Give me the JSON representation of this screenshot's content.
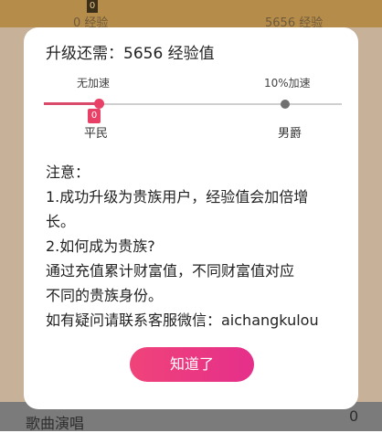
{
  "background": {
    "left_label": "0 经验",
    "right_label": "5656 经验",
    "badge": "0",
    "song_label": "歌曲演唱",
    "count": "0"
  },
  "dialog": {
    "title": "升级还需：5656 经验值",
    "progress": {
      "left_label": "无加速",
      "right_label": "10%加速",
      "level_badge": "0",
      "current_rank": "平民",
      "next_rank": "男爵",
      "fraction": 0.0
    },
    "notes": [
      "注意：",
      "1.成功升级为贵族用户，经验值会加倍增",
      "长。",
      "2.如何成为贵族?",
      "通过充值累计财富值，不同财富值对应",
      "不同的贵族身份。",
      "如有疑问请联系客服微信：aichangkulou"
    ],
    "button_label": "知道了"
  },
  "colors": {
    "accent": "#e84067",
    "button_gradient_start": "#f0437a",
    "button_gradient_end": "#e52f8a",
    "track": "#cfcfcf",
    "dim_background": "#c7b299"
  }
}
